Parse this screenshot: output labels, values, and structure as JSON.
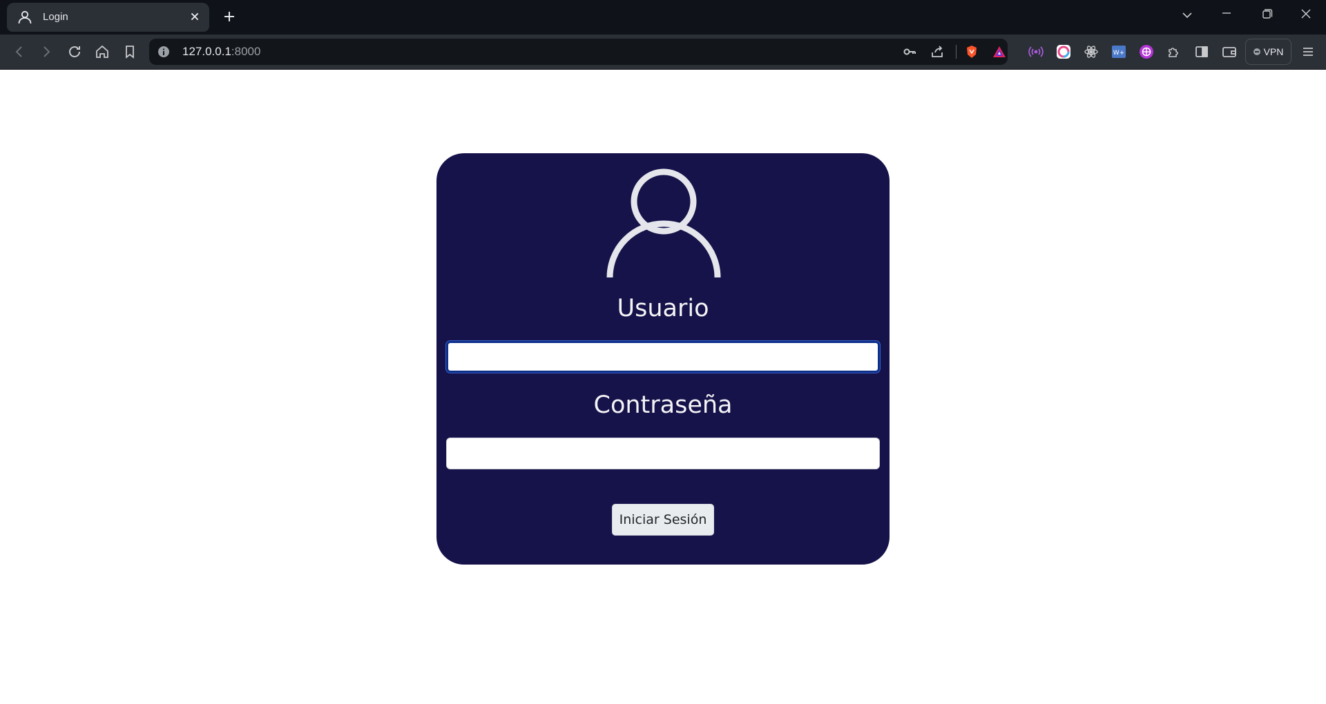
{
  "browser": {
    "tab": {
      "title": "Login"
    },
    "omnibox": {
      "host": "127.0.0.1",
      "port": ":8000"
    },
    "vpn_label": "VPN"
  },
  "login": {
    "username_label": "Usuario",
    "username_value": "",
    "password_label": "Contraseña",
    "password_value": "",
    "submit_label": "Iniciar Sesión"
  },
  "colors": {
    "card_bg": "#16124a",
    "page_bg": "#ffffff",
    "browser_bg": "#0f1218",
    "toolbar_bg": "#2b2f36",
    "input_focus": "#0c2f8a"
  },
  "icons": {
    "toolbar": [
      "back-icon",
      "forward-icon",
      "reload-icon",
      "home-icon",
      "bookmark-icon"
    ],
    "omnibox": [
      "info-icon",
      "key-icon",
      "share-icon",
      "brave-shield-icon",
      "brave-rewards-icon"
    ],
    "extensions": [
      "radio-waves-icon",
      "color-ring-icon",
      "react-devtools-icon",
      "word-extension-icon",
      "globe-extension-icon",
      "puzzle-icon",
      "sidebar-icon",
      "wallet-icon"
    ],
    "window": [
      "chevron-down-icon",
      "minimize-icon",
      "restore-icon",
      "close-icon"
    ]
  }
}
